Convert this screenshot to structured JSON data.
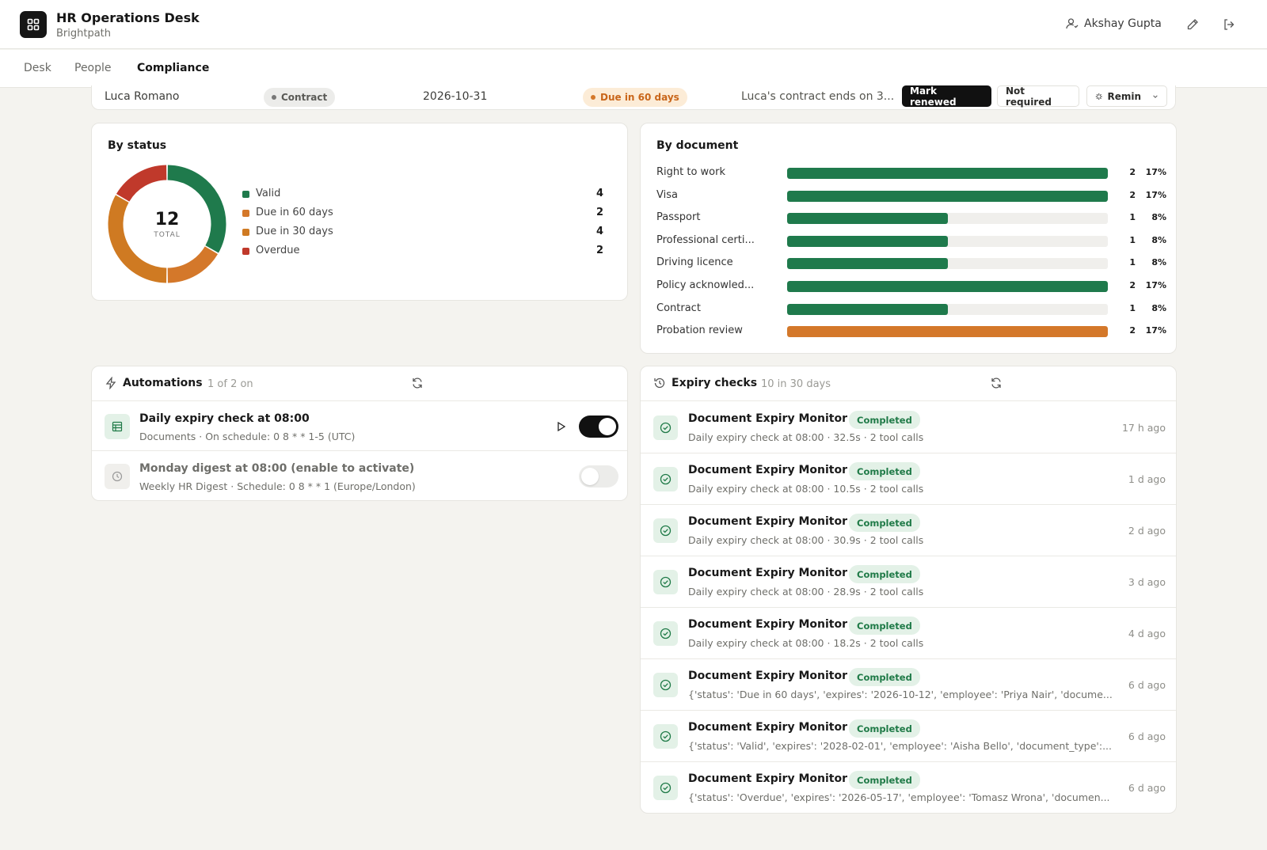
{
  "app": {
    "title": "HR Operations Desk",
    "subtitle": "Brightpath"
  },
  "user": {
    "name": "Akshay Gupta"
  },
  "tabs": [
    {
      "label": "Desk"
    },
    {
      "label": "People"
    },
    {
      "label": "Compliance",
      "active": true
    }
  ],
  "row": {
    "name": "Luca Romano",
    "doc_type": "Contract",
    "date": "2026-10-31",
    "status": "Due in 60 days",
    "note": "Luca's contract ends on 3...",
    "mark_renewed": "Mark renewed",
    "not_required": "Not required",
    "remind": "Remin"
  },
  "by_status": {
    "title": "By status",
    "total": "12",
    "total_label": "TOTAL",
    "items": [
      {
        "label": "Valid",
        "value": 4,
        "color": "#1f7a4c"
      },
      {
        "label": "Due in 60 days",
        "value": 2,
        "color": "#d4782a"
      },
      {
        "label": "Due in 30 days",
        "value": 4,
        "color": "#cf7a22"
      },
      {
        "label": "Overdue",
        "value": 2,
        "color": "#c0392b"
      }
    ]
  },
  "by_document": {
    "title": "By document",
    "items": [
      {
        "label": "Right to work",
        "count": "2",
        "pct": "17%",
        "fraction": 1.0,
        "color": "#1f7a4c"
      },
      {
        "label": "Visa",
        "count": "2",
        "pct": "17%",
        "fraction": 1.0,
        "color": "#1f7a4c"
      },
      {
        "label": "Passport",
        "count": "1",
        "pct": "8%",
        "fraction": 0.5,
        "color": "#1f7a4c"
      },
      {
        "label": "Professional certi...",
        "count": "1",
        "pct": "8%",
        "fraction": 0.5,
        "color": "#1f7a4c"
      },
      {
        "label": "Driving licence",
        "count": "1",
        "pct": "8%",
        "fraction": 0.5,
        "color": "#1f7a4c"
      },
      {
        "label": "Policy acknowled...",
        "count": "2",
        "pct": "17%",
        "fraction": 1.0,
        "color": "#1f7a4c"
      },
      {
        "label": "Contract",
        "count": "1",
        "pct": "8%",
        "fraction": 0.5,
        "color": "#1f7a4c"
      },
      {
        "label": "Probation review",
        "count": "2",
        "pct": "17%",
        "fraction": 1.0,
        "color": "#d4782a"
      }
    ]
  },
  "automations": {
    "title": "Automations",
    "subtitle": "1 of 2 on",
    "items": [
      {
        "title": "Daily expiry check at 08:00",
        "sub": "Documents · On schedule: 0 8 * * 1-5 (UTC)",
        "enabled": true
      },
      {
        "title": "Monday digest at 08:00 (enable to activate)",
        "sub": "Weekly HR Digest · Schedule: 0 8 * * 1 (Europe/London)",
        "enabled": false
      }
    ]
  },
  "expiry_checks": {
    "title": "Expiry checks",
    "subtitle": "10 in 30 days",
    "items": [
      {
        "title": "Document Expiry Monitor",
        "badge": "Completed",
        "sub": "Daily expiry check at 08:00 · 32.5s · 2 tool calls",
        "time": "17 h ago"
      },
      {
        "title": "Document Expiry Monitor",
        "badge": "Completed",
        "sub": "Daily expiry check at 08:00 · 10.5s · 2 tool calls",
        "time": "1 d ago"
      },
      {
        "title": "Document Expiry Monitor",
        "badge": "Completed",
        "sub": "Daily expiry check at 08:00 · 30.9s · 2 tool calls",
        "time": "2 d ago"
      },
      {
        "title": "Document Expiry Monitor",
        "badge": "Completed",
        "sub": "Daily expiry check at 08:00 · 28.9s · 2 tool calls",
        "time": "3 d ago"
      },
      {
        "title": "Document Expiry Monitor",
        "badge": "Completed",
        "sub": "Daily expiry check at 08:00 · 18.2s · 2 tool calls",
        "time": "4 d ago"
      },
      {
        "title": "Document Expiry Monitor",
        "badge": "Completed",
        "sub": "{'status': 'Due in 60 days', 'expires': '2026-10-12', 'employee': 'Priya Nair', 'docume...",
        "time": "6 d ago"
      },
      {
        "title": "Document Expiry Monitor",
        "badge": "Completed",
        "sub": "{'status': 'Valid', 'expires': '2028-02-01', 'employee': 'Aisha Bello', 'document_type':...",
        "time": "6 d ago"
      },
      {
        "title": "Document Expiry Monitor",
        "badge": "Completed",
        "sub": "{'status': 'Overdue', 'expires': '2026-05-17', 'employee': 'Tomasz Wrona', 'documen...",
        "time": "6 d ago"
      }
    ]
  }
}
